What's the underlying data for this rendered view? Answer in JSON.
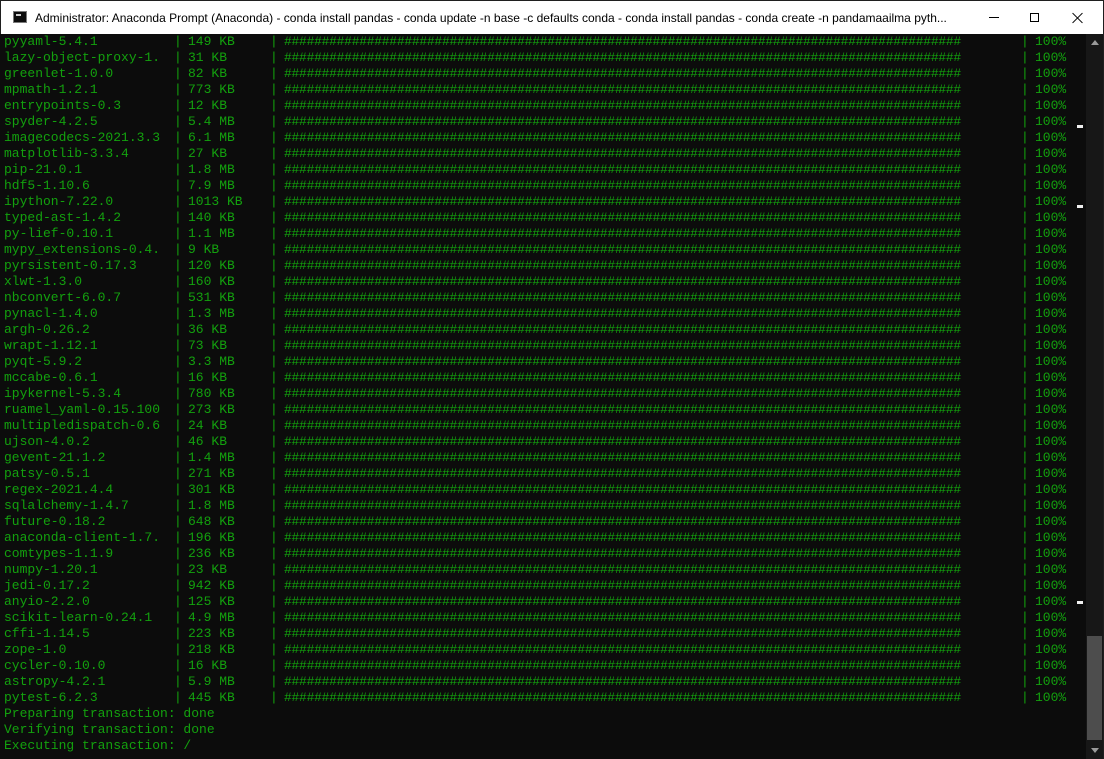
{
  "window": {
    "title": "Administrator: Anaconda Prompt (Anaconda) - conda  install pandas - conda  update -n base -c defaults conda - conda  install pandas - conda  create -n pandamaailma pyth...",
    "minimize_icon": "minimize-icon",
    "maximize_icon": "maximize-icon",
    "close_icon": "close-icon"
  },
  "theme": {
    "background": "#0c0c0c",
    "text": "#13a10e",
    "titlebar": "#ffffff",
    "scrollbar_thumb": "#4d4d4d"
  },
  "console": {
    "separator": "|",
    "progress_bar": "##########################################################################################",
    "packages": [
      {
        "name": "pyyaml-5.4.1",
        "size": "149 KB",
        "percent": "100%"
      },
      {
        "name": "lazy-object-proxy-1.",
        "size": "31 KB",
        "percent": "100%"
      },
      {
        "name": "greenlet-1.0.0",
        "size": "82 KB",
        "percent": "100%"
      },
      {
        "name": "mpmath-1.2.1",
        "size": "773 KB",
        "percent": "100%"
      },
      {
        "name": "entrypoints-0.3",
        "size": "12 KB",
        "percent": "100%"
      },
      {
        "name": "spyder-4.2.5",
        "size": "5.4 MB",
        "percent": "100%"
      },
      {
        "name": "imagecodecs-2021.3.3",
        "size": "6.1 MB",
        "percent": "100%"
      },
      {
        "name": "matplotlib-3.3.4",
        "size": "27 KB",
        "percent": "100%"
      },
      {
        "name": "pip-21.0.1",
        "size": "1.8 MB",
        "percent": "100%"
      },
      {
        "name": "hdf5-1.10.6",
        "size": "7.9 MB",
        "percent": "100%"
      },
      {
        "name": "ipython-7.22.0",
        "size": "1013 KB",
        "percent": "100%"
      },
      {
        "name": "typed-ast-1.4.2",
        "size": "140 KB",
        "percent": "100%"
      },
      {
        "name": "py-lief-0.10.1",
        "size": "1.1 MB",
        "percent": "100%"
      },
      {
        "name": "mypy_extensions-0.4.",
        "size": "9 KB",
        "percent": "100%"
      },
      {
        "name": "pyrsistent-0.17.3",
        "size": "120 KB",
        "percent": "100%"
      },
      {
        "name": "xlwt-1.3.0",
        "size": "160 KB",
        "percent": "100%"
      },
      {
        "name": "nbconvert-6.0.7",
        "size": "531 KB",
        "percent": "100%"
      },
      {
        "name": "pynacl-1.4.0",
        "size": "1.3 MB",
        "percent": "100%"
      },
      {
        "name": "argh-0.26.2",
        "size": "36 KB",
        "percent": "100%"
      },
      {
        "name": "wrapt-1.12.1",
        "size": "73 KB",
        "percent": "100%"
      },
      {
        "name": "pyqt-5.9.2",
        "size": "3.3 MB",
        "percent": "100%"
      },
      {
        "name": "mccabe-0.6.1",
        "size": "16 KB",
        "percent": "100%"
      },
      {
        "name": "ipykernel-5.3.4",
        "size": "780 KB",
        "percent": "100%"
      },
      {
        "name": "ruamel_yaml-0.15.100",
        "size": "273 KB",
        "percent": "100%"
      },
      {
        "name": "multipledispatch-0.6",
        "size": "24 KB",
        "percent": "100%"
      },
      {
        "name": "ujson-4.0.2",
        "size": "46 KB",
        "percent": "100%"
      },
      {
        "name": "gevent-21.1.2",
        "size": "1.4 MB",
        "percent": "100%"
      },
      {
        "name": "patsy-0.5.1",
        "size": "271 KB",
        "percent": "100%"
      },
      {
        "name": "regex-2021.4.4",
        "size": "301 KB",
        "percent": "100%"
      },
      {
        "name": "sqlalchemy-1.4.7",
        "size": "1.8 MB",
        "percent": "100%"
      },
      {
        "name": "future-0.18.2",
        "size": "648 KB",
        "percent": "100%"
      },
      {
        "name": "anaconda-client-1.7.",
        "size": "196 KB",
        "percent": "100%"
      },
      {
        "name": "comtypes-1.1.9",
        "size": "236 KB",
        "percent": "100%"
      },
      {
        "name": "numpy-1.20.1",
        "size": "23 KB",
        "percent": "100%"
      },
      {
        "name": "jedi-0.17.2",
        "size": "942 KB",
        "percent": "100%"
      },
      {
        "name": "anyio-2.2.0",
        "size": "125 KB",
        "percent": "100%"
      },
      {
        "name": "scikit-learn-0.24.1",
        "size": "4.9 MB",
        "percent": "100%"
      },
      {
        "name": "cffi-1.14.5",
        "size": "223 KB",
        "percent": "100%"
      },
      {
        "name": "zope-1.0",
        "size": "218 KB",
        "percent": "100%"
      },
      {
        "name": "cycler-0.10.0",
        "size": "16 KB",
        "percent": "100%"
      },
      {
        "name": "astropy-4.2.1",
        "size": "5.9 MB",
        "percent": "100%"
      },
      {
        "name": "pytest-6.2.3",
        "size": "445 KB",
        "percent": "100%"
      }
    ],
    "status_lines": [
      "Preparing transaction: done",
      "Verifying transaction: done",
      "Executing transaction: /"
    ]
  }
}
